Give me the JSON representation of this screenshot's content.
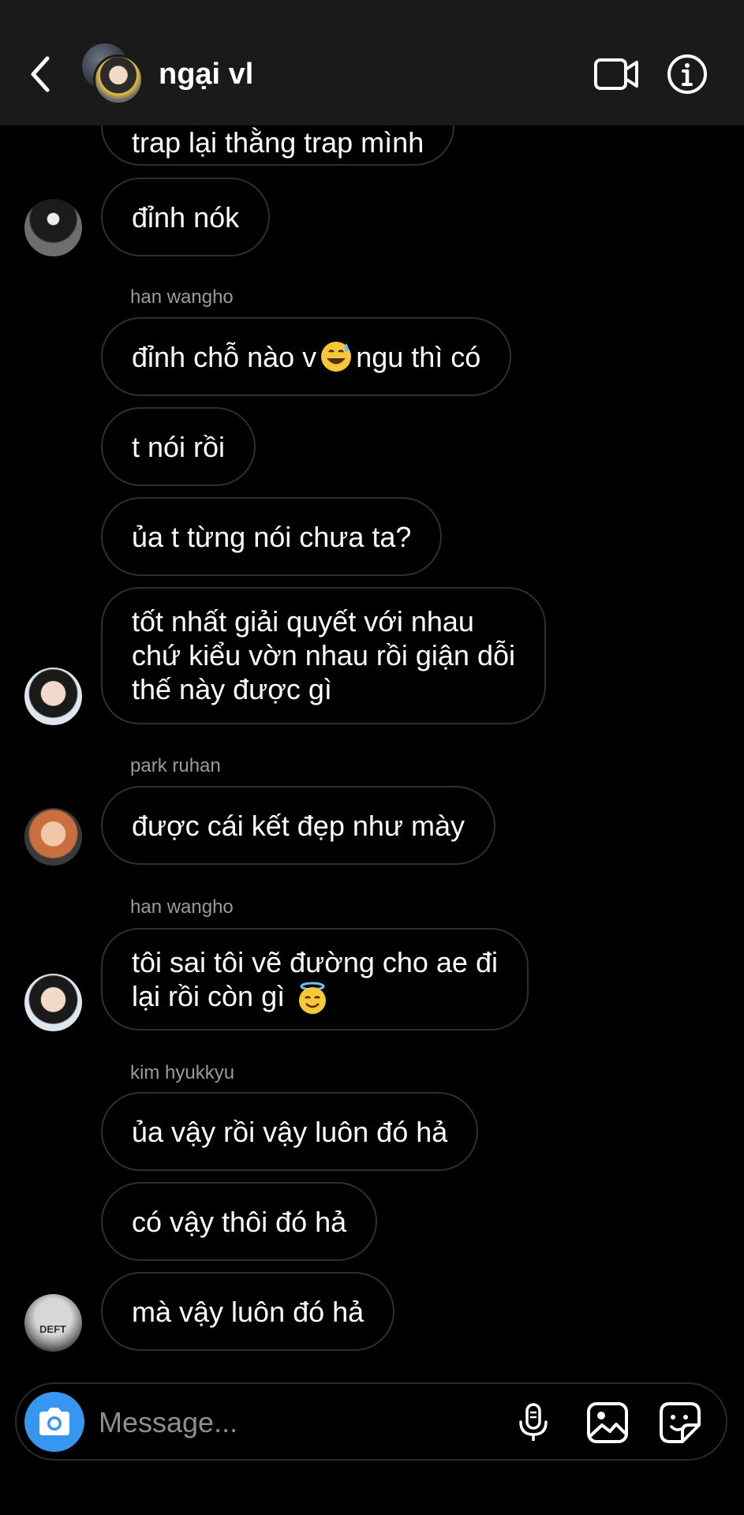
{
  "header": {
    "title": "ngại vl"
  },
  "messages": [
    {
      "text": "trap lại thằng trap mình"
    },
    {
      "text": "đỉnh nók"
    },
    {
      "sender": "han wangho"
    },
    {
      "text_a": "đỉnh chỗ nào v",
      "emoji": "grinning-sweat-emoji",
      "text_b": "ngu thì có"
    },
    {
      "text": "t nói rồi"
    },
    {
      "text": "ủa t từng nói chưa ta?"
    },
    {
      "line1": "tốt nhất giải quyết với nhau",
      "line2": "chứ kiểu vờn nhau rồi giận dỗi",
      "line3": "thế này được gì"
    },
    {
      "sender": "park ruhan"
    },
    {
      "text": "được cái kết đẹp như mày"
    },
    {
      "sender": "han wangho"
    },
    {
      "line1": "tôi sai tôi vẽ đường cho ae đi",
      "line2": "lại rồi còn gì",
      "emoji": "halo-smile-emoji"
    },
    {
      "sender": "kim hyukkyu"
    },
    {
      "text": "ủa vậy rồi vậy luôn đó hả"
    },
    {
      "text": "có vậy thôi đó hả"
    },
    {
      "text": "mà vậy luôn đó hả"
    }
  ],
  "avatars": {
    "last_avatar_text": "DEFT"
  },
  "composer": {
    "placeholder": "Message..."
  },
  "colors": {
    "header_bg": "#1a1a1a",
    "bubble_border": "#2f2f2f",
    "camera_blue": "#3797f0",
    "sender_gray": "#9a9a9a"
  }
}
